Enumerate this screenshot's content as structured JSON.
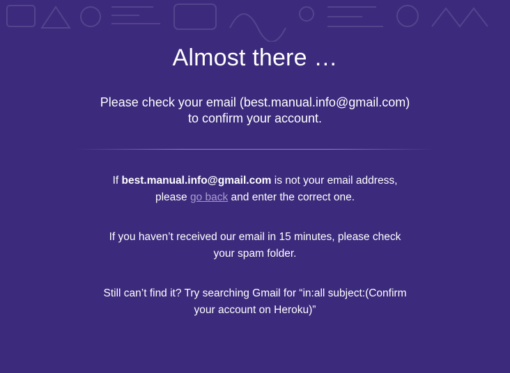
{
  "heading": "Almost there …",
  "confirm": {
    "prefix": "Please check your email (",
    "email": "best.manual.info@gmail.com",
    "suffix": ")",
    "line2": "to confirm your account."
  },
  "wrong_email": {
    "prefix": "If ",
    "email": "best.manual.info@gmail.com",
    "middle": " is not your email address, please ",
    "link": "go back",
    "suffix": " and enter the correct one."
  },
  "spam": {
    "text": "If you haven’t received our email in 15 minutes, please check your spam folder."
  },
  "search_tip": {
    "text": "Still can’t find it? Try searching Gmail for “in:all subject:(Confirm your account on Heroku)”"
  },
  "colors": {
    "background": "#3c2a7c",
    "link": "#a99bd3",
    "text": "#ffffff"
  }
}
